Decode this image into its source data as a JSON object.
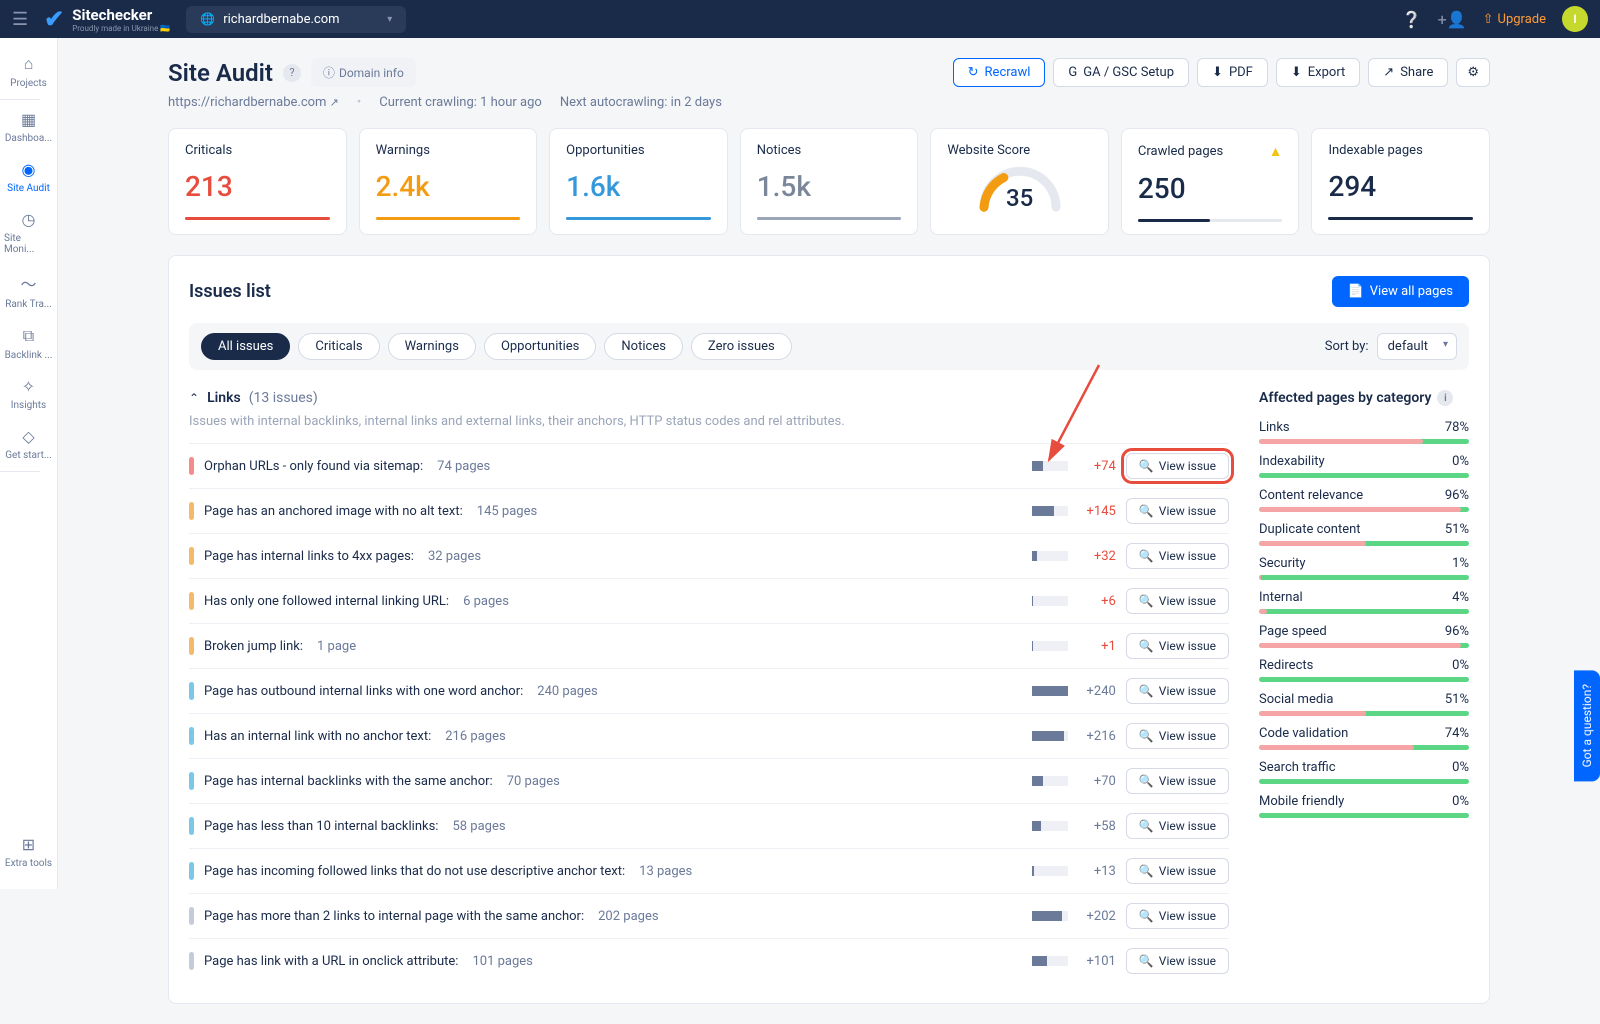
{
  "navbar": {
    "logo_title": "Sitechecker",
    "logo_sub": "Proudly made in Ukraine 🇺🇦",
    "site_domain": "richardbernabe.com",
    "upgrade": "Upgrade",
    "avatar_letter": "I"
  },
  "sidebar": {
    "items": [
      {
        "label": "Projects",
        "icon": "⌂"
      },
      {
        "label": "Dashboa...",
        "icon": "▦"
      },
      {
        "label": "Site Audit",
        "icon": "◉",
        "active": true
      },
      {
        "label": "Site Moni...",
        "icon": "◷"
      },
      {
        "label": "Rank Tra...",
        "icon": "〜"
      },
      {
        "label": "Backlink ...",
        "icon": "⧉"
      },
      {
        "label": "Insights",
        "icon": "✧"
      },
      {
        "label": "Get start...",
        "icon": "◇"
      }
    ],
    "bottom": {
      "label": "Extra tools",
      "icon": "⊞"
    }
  },
  "header": {
    "title": "Site Audit",
    "domain_info": "Domain info",
    "url": "https://richardbernabe.com",
    "crawl_status": "Current crawling: 1 hour ago",
    "next_crawl": "Next autocrawling: in 2 days",
    "actions": {
      "recrawl": "Recrawl",
      "gagsc": "GA / GSC Setup",
      "pdf": "PDF",
      "export": "Export",
      "share": "Share"
    }
  },
  "stats": {
    "criticals": {
      "label": "Criticals",
      "value": "213"
    },
    "warnings": {
      "label": "Warnings",
      "value": "2.4k"
    },
    "opportunities": {
      "label": "Opportunities",
      "value": "1.6k"
    },
    "notices": {
      "label": "Notices",
      "value": "1.5k"
    },
    "score": {
      "label": "Website Score",
      "value": "35"
    },
    "crawled": {
      "label": "Crawled pages",
      "value": "250"
    },
    "indexable": {
      "label": "Indexable pages",
      "value": "294"
    }
  },
  "issues": {
    "title": "Issues list",
    "view_all": "View all pages",
    "filters": [
      "All issues",
      "Criticals",
      "Warnings",
      "Opportunities",
      "Notices",
      "Zero issues"
    ],
    "sort_label": "Sort by:",
    "sort_value": "default",
    "section": {
      "name": "Links",
      "count": "(13 issues)",
      "desc": "Issues with internal backlinks, internal links and external links, their anchors, HTTP status codes and rel attributes."
    },
    "rows": [
      {
        "sev": "red",
        "name": "Orphan URLs - only found via sitemap:",
        "pages": "74 pages",
        "bar": 32,
        "delta": "+74",
        "dclass": "red",
        "highlight": true
      },
      {
        "sev": "orange",
        "name": "Page has an anchored image with no alt text:",
        "pages": "145 pages",
        "bar": 62,
        "delta": "+145",
        "dclass": "red"
      },
      {
        "sev": "orange",
        "name": "Page has internal links to 4xx pages:",
        "pages": "32 pages",
        "bar": 14,
        "delta": "+32",
        "dclass": "red"
      },
      {
        "sev": "orange",
        "name": "Has only one followed internal linking URL:",
        "pages": "6 pages",
        "bar": 4,
        "delta": "+6",
        "dclass": "red"
      },
      {
        "sev": "orange",
        "name": "Broken jump link:",
        "pages": "1 page",
        "bar": 2,
        "delta": "+1",
        "dclass": "red"
      },
      {
        "sev": "blue",
        "name": "Page has outbound internal links with one word anchor:",
        "pages": "240 pages",
        "bar": 100,
        "delta": "+240",
        "dclass": "gray"
      },
      {
        "sev": "blue",
        "name": "Has an internal link with no anchor text:",
        "pages": "216 pages",
        "bar": 90,
        "delta": "+216",
        "dclass": "gray"
      },
      {
        "sev": "blue",
        "name": "Page has internal backlinks with the same anchor:",
        "pages": "70 pages",
        "bar": 30,
        "delta": "+70",
        "dclass": "gray"
      },
      {
        "sev": "blue",
        "name": "Page has less than 10 internal backlinks:",
        "pages": "58 pages",
        "bar": 25,
        "delta": "+58",
        "dclass": "gray"
      },
      {
        "sev": "blue",
        "name": "Page has incoming followed links that do not use descriptive anchor text:",
        "pages": "13 pages",
        "bar": 6,
        "delta": "+13",
        "dclass": "gray"
      },
      {
        "sev": "gray",
        "name": "Page has more than 2 links to internal page with the same anchor:",
        "pages": "202 pages",
        "bar": 85,
        "delta": "+202",
        "dclass": "gray"
      },
      {
        "sev": "gray",
        "name": "Page has link with a URL in onclick attribute:",
        "pages": "101 pages",
        "bar": 43,
        "delta": "+101",
        "dclass": "gray"
      }
    ],
    "view_issue": "View issue"
  },
  "categories": {
    "title": "Affected pages by category",
    "rows": [
      {
        "name": "Links",
        "pct": "78%",
        "red": 78
      },
      {
        "name": "Indexability",
        "pct": "0%",
        "red": 0
      },
      {
        "name": "Content relevance",
        "pct": "96%",
        "red": 96
      },
      {
        "name": "Duplicate content",
        "pct": "51%",
        "red": 51
      },
      {
        "name": "Security",
        "pct": "1%",
        "red": 1
      },
      {
        "name": "Internal",
        "pct": "4%",
        "red": 4
      },
      {
        "name": "Page speed",
        "pct": "96%",
        "red": 96
      },
      {
        "name": "Redirects",
        "pct": "0%",
        "red": 0
      },
      {
        "name": "Social media",
        "pct": "51%",
        "red": 51
      },
      {
        "name": "Code validation",
        "pct": "74%",
        "red": 74
      },
      {
        "name": "Search traffic",
        "pct": "0%",
        "red": 0
      },
      {
        "name": "Mobile friendly",
        "pct": "0%",
        "red": 0
      }
    ]
  },
  "help_tab": "Got a question?"
}
